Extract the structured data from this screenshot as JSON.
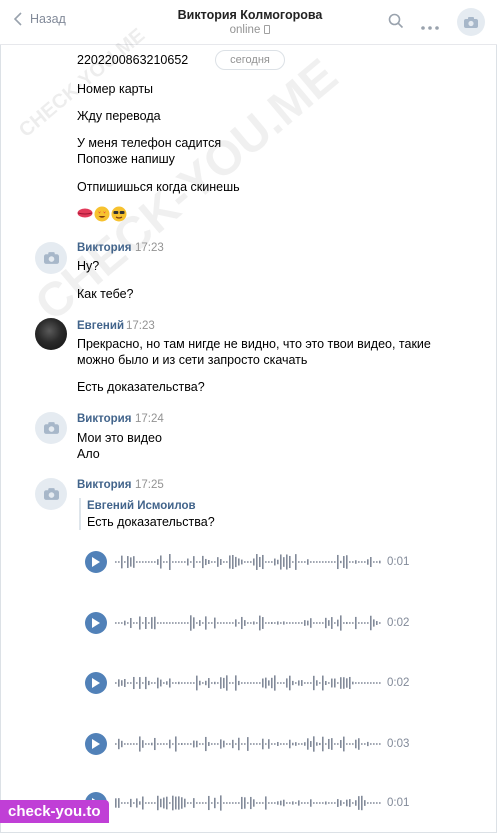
{
  "header": {
    "back_label": "Назад",
    "title": "Виктория Колмогорова",
    "status": "online"
  },
  "date_separator": "сегодня",
  "messages": {
    "card_number": "2202200863210652",
    "m1": "Номер карты",
    "m2": "Жду перевода",
    "m3": "У меня телефон садится\nПопозже напишу",
    "m4": "Отпишишься когда скинешь",
    "g1": {
      "sender": "Виктория",
      "time": "17:23",
      "l1": "Ну?",
      "l2": "Как тебе?"
    },
    "g2": {
      "sender": "Евгений",
      "time": "17:23",
      "l1": "Прекрасно, но там нигде не видно, что это твои видео, такие\nможно было и из сети запросто скачать",
      "l2": "Есть доказательства?"
    },
    "g3": {
      "sender": "Виктория",
      "time": "17:24",
      "l1": "Мои это видео\nАло"
    },
    "g4": {
      "sender": "Виктория",
      "time": "17:25",
      "forward": {
        "name": "Евгений Исмоилов",
        "text": "Есть доказательства?"
      }
    }
  },
  "voice_messages": [
    {
      "duration": "0:01"
    },
    {
      "duration": "0:02"
    },
    {
      "duration": "0:02"
    },
    {
      "duration": "0:03"
    },
    {
      "duration": "0:01"
    }
  ],
  "watermark": {
    "text_1": "CHECK-YOU.ME",
    "text_2": "CHECK-YOU.ME"
  },
  "badge": "check-you.to",
  "colors": {
    "accent": "#5181b8",
    "sender": "#42648b",
    "badge": "#c03fd6"
  }
}
